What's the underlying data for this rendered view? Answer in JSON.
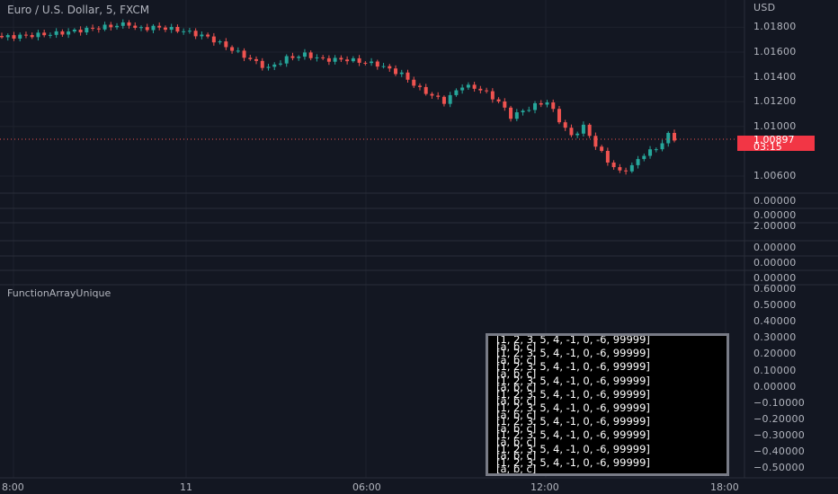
{
  "header": {
    "symbol_title": "Euro / U.S. Dollar, 5, FXCM",
    "currency": "USD"
  },
  "price_tag": {
    "price": "1.00897",
    "countdown": "03:15",
    "color": "#f23645"
  },
  "price_axis": [
    {
      "label": "1.01800",
      "value": 1.018
    },
    {
      "label": "1.01600",
      "value": 1.016
    },
    {
      "label": "1.01400",
      "value": 1.014
    },
    {
      "label": "1.01200",
      "value": 1.012
    },
    {
      "label": "1.01000",
      "value": 1.01
    },
    {
      "label": "1.00600",
      "value": 1.006
    }
  ],
  "sub_pane_axis": [
    "0.00000",
    "0.00000",
    "2.00000",
    "0.00000",
    "0.00000",
    "0.00000"
  ],
  "indicator": {
    "title": "FunctionArrayUnique",
    "axis": [
      "0.60000",
      "0.50000",
      "0.40000",
      "0.30000",
      "0.20000",
      "0.10000",
      "0.00000",
      "−0.10000",
      "−0.20000",
      "−0.30000",
      "−0.40000",
      "−0.50000"
    ]
  },
  "table_lines": [
    "[1, 2, 3, 5, 4, -1, 0, -6, 99999]",
    "[a, b, c]",
    "[1, 2, 3, 5, 4, -1, 0, -6, 99999]",
    "[a, b, c]",
    "[1, 2, 3, 5, 4, -1, 0, -6, 99999]",
    "[a, b, c]",
    "[1, 2, 3, 5, 4, -1, 0, -6, 99999]",
    "[a, b, c]",
    "[1, 2, 3, 5, 4, -1, 0, -6, 99999]",
    "[a, b, c]",
    "[1, 2, 3, 5, 4, -1, 0, -6, 99999]",
    "[a, b, c]",
    "[1, 2, 3, 5, 4, -1, 0, -6, 99999]",
    "[a, b, c]",
    "[1, 2, 3, 5, 4, -1, 0, -6, 99999]",
    "[a, b, c]",
    "[1, 2, 3, 5, 4, -1, 0, -6, 99999]",
    "[a, b, c]",
    "[1, 2, 3, 5, 4, -1, 0, -6, 99999]",
    "[a, b, c]"
  ],
  "time_axis": [
    "8:00",
    "11",
    "06:00",
    "12:00",
    "18:00"
  ],
  "colors": {
    "up": "#26a69a",
    "down": "#ef5350",
    "bg": "#131722",
    "grid": "#1e222d"
  },
  "chart_data": {
    "type": "candlestick",
    "symbol": "EURUSD",
    "timeframe": "5",
    "ylim": [
      1.005,
      1.0195
    ],
    "close_path": [
      [
        0,
        1.0172
      ],
      [
        9,
        1.0175
      ],
      [
        18,
        1.0181
      ],
      [
        21,
        1.0183
      ],
      [
        22,
        1.0179
      ],
      [
        26,
        1.018
      ],
      [
        30,
        1.0177
      ],
      [
        34,
        1.0172
      ],
      [
        38,
        1.0162
      ],
      [
        43,
        1.0149
      ],
      [
        44,
        1.0147
      ],
      [
        47,
        1.0155
      ],
      [
        50,
        1.0158
      ],
      [
        53,
        1.0154
      ],
      [
        57,
        1.0154
      ],
      [
        62,
        1.015
      ],
      [
        66,
        1.0142
      ],
      [
        69,
        1.013
      ],
      [
        73,
        1.012
      ],
      [
        76,
        1.0133
      ],
      [
        79,
        1.013
      ],
      [
        82,
        1.012
      ],
      [
        84,
        1.0108
      ],
      [
        88,
        1.0117
      ],
      [
        90,
        1.012
      ],
      [
        92,
        1.0105
      ],
      [
        94,
        1.0092
      ],
      [
        96,
        1.01
      ],
      [
        98,
        1.0085
      ],
      [
        100,
        1.0072
      ],
      [
        102,
        1.0063
      ],
      [
        104,
        1.0068
      ],
      [
        106,
        1.0078
      ],
      [
        108,
        1.0082
      ],
      [
        110,
        1.0093
      ],
      [
        111,
        1.009
      ]
    ],
    "last_price": 1.00897
  }
}
